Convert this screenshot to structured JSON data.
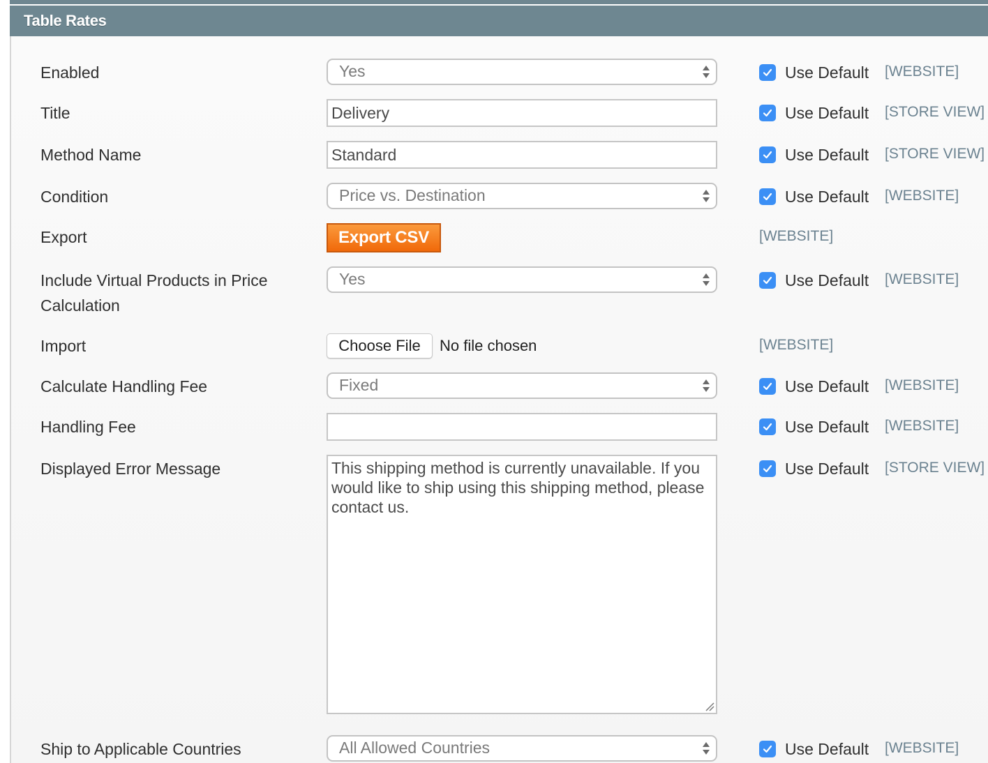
{
  "section": {
    "title": "Table Rates"
  },
  "fields": [
    {
      "label": "Enabled",
      "type": "select",
      "value": "Yes",
      "use_default": true,
      "use_default_label": "Use Default",
      "scope": "[WEBSITE]"
    },
    {
      "label": "Title",
      "type": "text",
      "value": "Delivery",
      "use_default": true,
      "use_default_label": "Use Default",
      "scope": "[STORE VIEW]"
    },
    {
      "label": "Method Name",
      "type": "text",
      "value": "Standard",
      "use_default": true,
      "use_default_label": "Use Default",
      "scope": "[STORE VIEW]"
    },
    {
      "label": "Condition",
      "type": "select",
      "value": "Price vs. Destination",
      "use_default": true,
      "use_default_label": "Use Default",
      "scope": "[WEBSITE]"
    },
    {
      "label": "Export",
      "type": "button",
      "value": "Export CSV",
      "scope": "[WEBSITE]"
    },
    {
      "label": "Include Virtual Products in Price Calculation",
      "type": "select",
      "value": "Yes",
      "use_default": true,
      "use_default_label": "Use Default",
      "scope": "[WEBSITE]"
    },
    {
      "label": "Import",
      "type": "file",
      "button_label": "Choose File",
      "value": "No file chosen",
      "scope": "[WEBSITE]"
    },
    {
      "label": "Calculate Handling Fee",
      "type": "select",
      "value": "Fixed",
      "use_default": true,
      "use_default_label": "Use Default",
      "scope": "[WEBSITE]"
    },
    {
      "label": "Handling Fee",
      "type": "text",
      "value": "",
      "use_default": true,
      "use_default_label": "Use Default",
      "scope": "[WEBSITE]"
    },
    {
      "label": "Displayed Error Message",
      "type": "textarea",
      "value": "This shipping method is currently unavailable. If you would like to ship using this shipping method, please contact us.",
      "use_default": true,
      "use_default_label": "Use Default",
      "scope": "[STORE VIEW]"
    },
    {
      "label": "Ship to Applicable Countries",
      "type": "select",
      "value": "All Allowed Countries",
      "use_default": true,
      "use_default_label": "Use Default",
      "scope": "[WEBSITE]"
    }
  ],
  "colors": {
    "header_bg": "#6e8791",
    "accent_button": "#f0690a",
    "checkbox": "#3b8ff5",
    "scope_text": "#6b8290"
  }
}
